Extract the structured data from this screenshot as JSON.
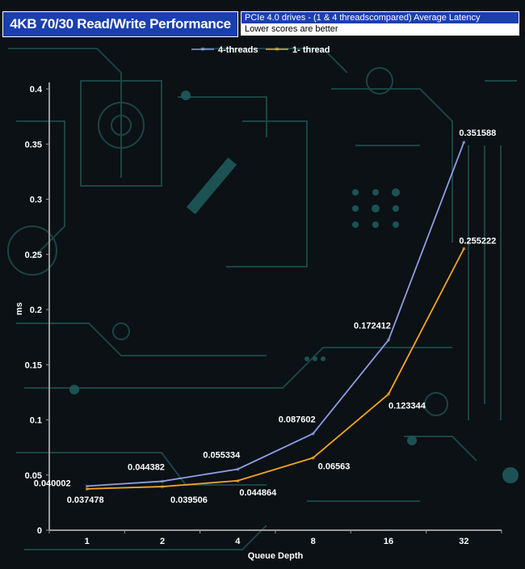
{
  "header": {
    "title": "4KB 70/30 Read/Write Performance",
    "subtitle_line1": "PCIe 4.0 drives - (1 & 4 threadscompared)  Average Latency",
    "subtitle_line2": "Lower scores are better"
  },
  "chart_data": {
    "type": "line",
    "title": "4KB 70/30 Read/Write Performance",
    "xlabel": "Queue Depth",
    "ylabel": "ms",
    "categories": [
      "1",
      "2",
      "4",
      "8",
      "16",
      "32"
    ],
    "ylim": [
      0,
      0.4
    ],
    "yticks": [
      "0",
      "0.05",
      "0.1",
      "0.15",
      "0.2",
      "0.25",
      "0.3",
      "0.35",
      "0.4"
    ],
    "legend_position": "top-center",
    "series": [
      {
        "name": "4-threads",
        "color": "#8f9ee6",
        "values": [
          0.040002,
          0.044382,
          0.055334,
          0.087602,
          0.172412,
          0.351588
        ],
        "labels": [
          "0.040002",
          "0.044382",
          "0.055334",
          "0.087602",
          "0.172412",
          "0.351588"
        ]
      },
      {
        "name": "1- thread",
        "color": "#f5a623",
        "values": [
          0.037478,
          0.039506,
          0.044864,
          0.06563,
          0.123344,
          0.255222
        ],
        "labels": [
          "0.037478",
          "0.039506",
          "0.044864",
          "0.06563",
          "0.123344",
          "0.255222"
        ]
      }
    ]
  }
}
